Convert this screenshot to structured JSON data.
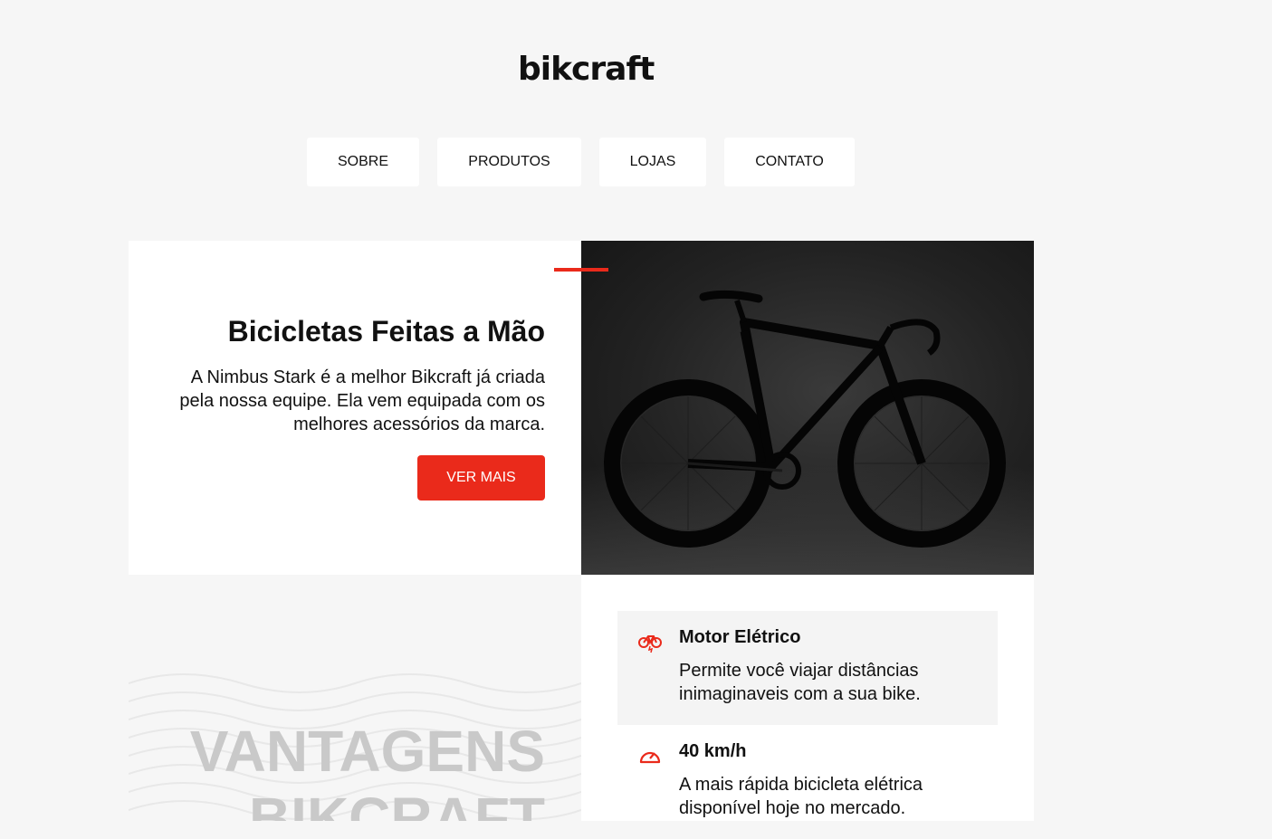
{
  "brand": {
    "logo": "bikcraft"
  },
  "nav": [
    {
      "label": "SOBRE"
    },
    {
      "label": "PRODUTOS"
    },
    {
      "label": "LOJAS"
    },
    {
      "label": "CONTATO"
    }
  ],
  "hero": {
    "title": "Bicicletas Feitas a Mão",
    "text": "A Nimbus Stark é a melhor Bikcraft já criada pela nossa equipe. Ela vem equipada com os melhores acessórios da marca.",
    "button": "VER MAIS",
    "image": "black-road-bike-photo"
  },
  "advantages": {
    "title_line1": "VANTAGENS",
    "title_line2": "BIKCRAFT",
    "items": [
      {
        "icon": "electric-bike-icon",
        "title": "Motor Elétrico",
        "text": "Permite você viajar distâncias inimaginaveis com a sua bike."
      },
      {
        "icon": "speedometer-icon",
        "title": "40 km/h",
        "text": "A mais rápida bicicleta elétrica disponível hoje no mercado."
      }
    ]
  },
  "colors": {
    "accent": "#ea2a1b",
    "background": "#f6f6f6",
    "surface": "#ffffff"
  }
}
